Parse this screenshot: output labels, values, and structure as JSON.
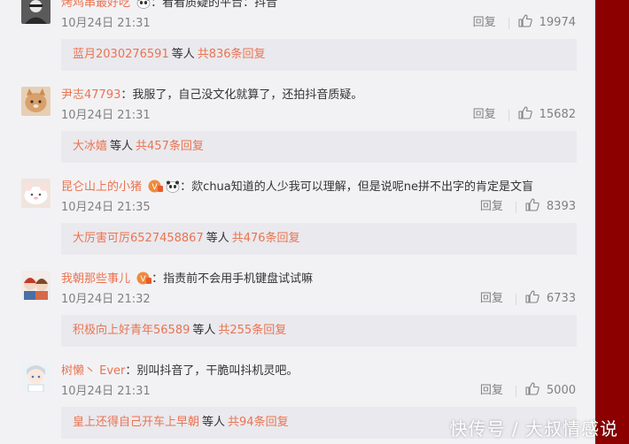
{
  "colors": {
    "background_red": "#8c0000",
    "panel": "#f2f2f5",
    "reply_box": "#e9e9ee",
    "username": "#eb7350",
    "meta_gray": "#808080"
  },
  "comments": [
    {
      "username": "烤鸡串最好吃",
      "badges": [
        "panda-icon"
      ],
      "text": "看看质疑的平台：抖音",
      "time": "10月24日 21:31",
      "reply_label": "回复",
      "likes": "19974",
      "replies": {
        "user": "蓝月2030276591",
        "etc": "等人",
        "total": "共836条回复"
      }
    },
    {
      "username": "尹志47793",
      "badges": [],
      "text": "我服了，自己没文化就算了，还拍抖音质疑。",
      "time": "10月24日 21:31",
      "reply_label": "回复",
      "likes": "15682",
      "replies": {
        "user": "大冰嬉",
        "etc": "等人",
        "total": "共457条回复"
      }
    },
    {
      "username": "昆仑山上的小猪",
      "badges": [
        "fan-badge-icon",
        "panda-icon"
      ],
      "text": "欻chua知道的人少我可以理解，但是说呢ne拼不出字的肯定是文盲",
      "time": "10月24日 21:35",
      "reply_label": "回复",
      "likes": "8393",
      "replies": {
        "user": "大厉害可厉6527458867",
        "etc": "等人",
        "total": "共476条回复"
      }
    },
    {
      "username": "我朝那些事儿",
      "badges": [
        "fan-badge-icon"
      ],
      "text": "指责前不会用手机键盘试试嘛",
      "time": "10月24日 21:32",
      "reply_label": "回复",
      "likes": "6733",
      "replies": {
        "user": "积极向上好青年56589",
        "etc": "等人",
        "total": "共255条回复"
      }
    },
    {
      "username": "树懒丶 Ever",
      "badges": [],
      "text": "别叫抖音了，干脆叫抖机灵吧。",
      "time": "10月24日 21:31",
      "reply_label": "回复",
      "likes": "5000",
      "replies": {
        "user": "皇上还得自己开车上早朝",
        "etc": "等人",
        "total": "共94条回复"
      }
    }
  ],
  "watermark": "快传号 / 大叔情感说"
}
